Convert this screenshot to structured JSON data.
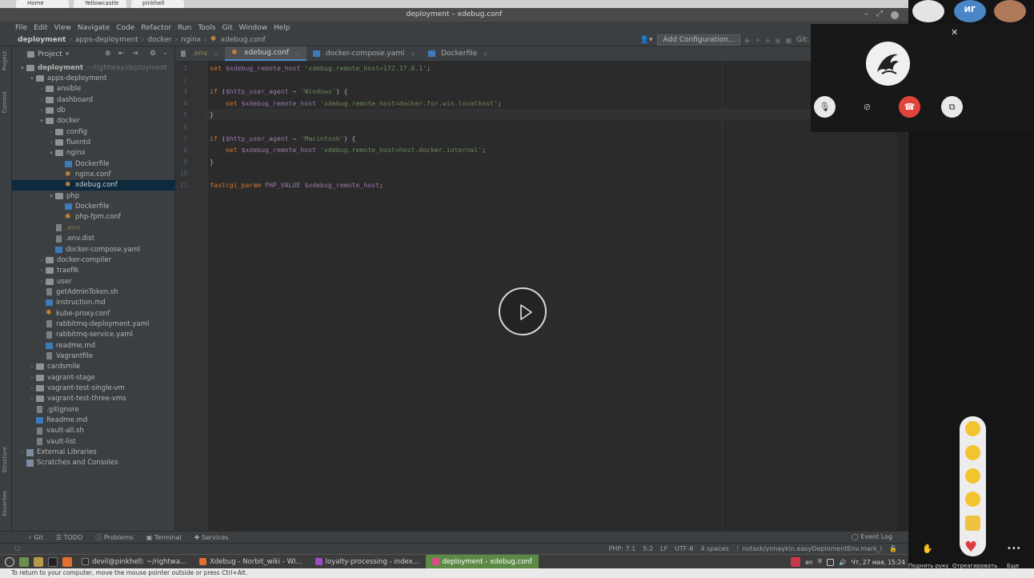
{
  "browser_tabs": [
    "Home",
    "Yellowcastle",
    "pinkhell"
  ],
  "window_title": "deployment – xdebug.conf",
  "menu": [
    "File",
    "Edit",
    "View",
    "Navigate",
    "Code",
    "Refactor",
    "Run",
    "Tools",
    "Git",
    "Window",
    "Help"
  ],
  "breadcrumb": [
    "deployment",
    "apps-deployment",
    "docker",
    "nginx",
    "xdebug.conf"
  ],
  "toolbar": {
    "add_config": "Add Configuration...",
    "git_label": "Git:"
  },
  "project_panel": {
    "title": "Project"
  },
  "tree": [
    {
      "label": "deployment",
      "extra": "~/rightway/deployment",
      "depth": 0,
      "kind": "folder",
      "open": true,
      "bold": true
    },
    {
      "label": "apps-deployment",
      "depth": 1,
      "kind": "folder",
      "open": true
    },
    {
      "label": "ansible",
      "depth": 2,
      "kind": "folder",
      "open": false
    },
    {
      "label": "dashboard",
      "depth": 2,
      "kind": "folder",
      "open": false
    },
    {
      "label": "db",
      "depth": 2,
      "kind": "folder",
      "open": false
    },
    {
      "label": "docker",
      "depth": 2,
      "kind": "folder",
      "open": true
    },
    {
      "label": "config",
      "depth": 3,
      "kind": "folder",
      "open": false
    },
    {
      "label": "fluentd",
      "depth": 3,
      "kind": "folder",
      "open": false
    },
    {
      "label": "nginx",
      "depth": 3,
      "kind": "folder",
      "open": true
    },
    {
      "label": "Dockerfile",
      "depth": 4,
      "kind": "docker"
    },
    {
      "label": "nginx.conf",
      "depth": 4,
      "kind": "conf"
    },
    {
      "label": "xdebug.conf",
      "depth": 4,
      "kind": "conf",
      "selected": true
    },
    {
      "label": "php",
      "depth": 3,
      "kind": "folder",
      "open": true
    },
    {
      "label": "Dockerfile",
      "depth": 4,
      "kind": "docker"
    },
    {
      "label": "php-fpm.conf",
      "depth": 4,
      "kind": "conf"
    },
    {
      "label": ".env",
      "depth": 3,
      "kind": "file",
      "dim": true
    },
    {
      "label": ".env.dist",
      "depth": 3,
      "kind": "file"
    },
    {
      "label": "docker-compose.yaml",
      "depth": 3,
      "kind": "docker"
    },
    {
      "label": "docker-compiler",
      "depth": 2,
      "kind": "folder",
      "open": false
    },
    {
      "label": "traefik",
      "depth": 2,
      "kind": "folder",
      "open": false
    },
    {
      "label": "user",
      "depth": 2,
      "kind": "folder",
      "open": false
    },
    {
      "label": "getAdminToken.sh",
      "depth": 2,
      "kind": "file"
    },
    {
      "label": "instruction.md",
      "depth": 2,
      "kind": "docker"
    },
    {
      "label": "kube-proxy.conf",
      "depth": 2,
      "kind": "conf"
    },
    {
      "label": "rabbitmq-deployment.yaml",
      "depth": 2,
      "kind": "file"
    },
    {
      "label": "rabbitmq-service.yaml",
      "depth": 2,
      "kind": "file"
    },
    {
      "label": "readme.md",
      "depth": 2,
      "kind": "docker"
    },
    {
      "label": "Vagrantfile",
      "depth": 2,
      "kind": "file"
    },
    {
      "label": "cardsmile",
      "depth": 1,
      "kind": "folder",
      "open": false
    },
    {
      "label": "vagrant-stage",
      "depth": 1,
      "kind": "folder",
      "open": false
    },
    {
      "label": "vagrant-test-single-vm",
      "depth": 1,
      "kind": "folder",
      "open": false
    },
    {
      "label": "vagrant-test-three-vms",
      "depth": 1,
      "kind": "folder",
      "open": false
    },
    {
      "label": ".gitignore",
      "depth": 1,
      "kind": "file"
    },
    {
      "label": "Readme.md",
      "depth": 1,
      "kind": "docker"
    },
    {
      "label": "vault-all.sh",
      "depth": 1,
      "kind": "file"
    },
    {
      "label": "vault-list",
      "depth": 1,
      "kind": "file"
    },
    {
      "label": "External Libraries",
      "depth": 0,
      "kind": "lib",
      "open": false
    },
    {
      "label": "Scratches and Consoles",
      "depth": 0,
      "kind": "lib",
      "noarrow": true
    }
  ],
  "editor_tabs": [
    {
      "label": ".env",
      "active": false
    },
    {
      "label": "xdebug.conf",
      "active": true
    },
    {
      "label": "docker-compose.yaml",
      "active": false
    },
    {
      "label": "Dockerfile",
      "active": false
    }
  ],
  "code_lines": [
    "set $xdebug_remote_host 'xdebug.remote_host=172.17.0.1';",
    "",
    "if ($http_user_agent ~ 'Windows') {",
    "    set $xdebug_remote_host 'xdebug.remote_host=docker.for.win.localhost';",
    "}",
    "",
    "if ($http_user_agent ~ 'Macintosh') {",
    "    set $xdebug_remote_host 'xdebug.remote_host=host.docker.internal';",
    "}",
    "",
    "fastcgi_param PHP_VALUE $xdebug_remote_host;"
  ],
  "line_numbers": [
    "1",
    "2",
    "3",
    "4",
    "5",
    "6",
    "7",
    "8",
    "9",
    "10",
    "11"
  ],
  "bottom_tools": [
    "Git",
    "TODO",
    "Problems",
    "Terminal",
    "Services"
  ],
  "event_log": "Event Log",
  "status": [
    "PHP: 7.1",
    "5:2",
    "LF",
    "UTF-8",
    "4 spaces",
    "notask/yimaykin.easyDeplomentEnv.mark_l"
  ],
  "taskbar": [
    {
      "label": "devil@pinkhell: ~/rightwa...",
      "color": "#2b2b2b",
      "active": false
    },
    {
      "label": "Xdebug - Norbit_wiki - WI...",
      "color": "#e0702e",
      "active": false
    },
    {
      "label": "loyalty-processing - index...",
      "color": "#a04cc8",
      "active": false
    },
    {
      "label": "deployment - xdebug.conf",
      "color": "#e04a8a",
      "active": true
    }
  ],
  "tray": {
    "lang": "en",
    "clock": "Чт, 27 мая, 15:24"
  },
  "hint": "To return to your computer, move the mouse pointer outside or press Ctrl+Alt.",
  "call": {
    "participant_initials": "ИГ",
    "raise_hand_label": "Поднять руку",
    "react_label": "Отреагировать",
    "more_label": "Еще"
  }
}
